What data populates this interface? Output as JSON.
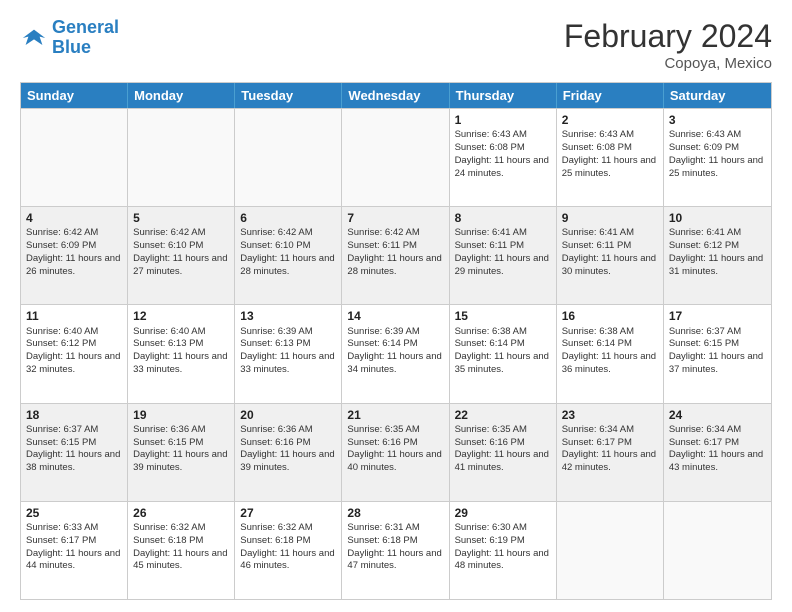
{
  "logo": {
    "line1": "General",
    "line2": "Blue"
  },
  "title": "February 2024",
  "location": "Copoya, Mexico",
  "days_header": [
    "Sunday",
    "Monday",
    "Tuesday",
    "Wednesday",
    "Thursday",
    "Friday",
    "Saturday"
  ],
  "rows": [
    [
      {
        "day": "",
        "info": "",
        "empty": true
      },
      {
        "day": "",
        "info": "",
        "empty": true
      },
      {
        "day": "",
        "info": "",
        "empty": true
      },
      {
        "day": "",
        "info": "",
        "empty": true
      },
      {
        "day": "1",
        "info": "Sunrise: 6:43 AM\nSunset: 6:08 PM\nDaylight: 11 hours and 24 minutes."
      },
      {
        "day": "2",
        "info": "Sunrise: 6:43 AM\nSunset: 6:08 PM\nDaylight: 11 hours and 25 minutes."
      },
      {
        "day": "3",
        "info": "Sunrise: 6:43 AM\nSunset: 6:09 PM\nDaylight: 11 hours and 25 minutes."
      }
    ],
    [
      {
        "day": "4",
        "info": "Sunrise: 6:42 AM\nSunset: 6:09 PM\nDaylight: 11 hours and 26 minutes."
      },
      {
        "day": "5",
        "info": "Sunrise: 6:42 AM\nSunset: 6:10 PM\nDaylight: 11 hours and 27 minutes."
      },
      {
        "day": "6",
        "info": "Sunrise: 6:42 AM\nSunset: 6:10 PM\nDaylight: 11 hours and 28 minutes."
      },
      {
        "day": "7",
        "info": "Sunrise: 6:42 AM\nSunset: 6:11 PM\nDaylight: 11 hours and 28 minutes."
      },
      {
        "day": "8",
        "info": "Sunrise: 6:41 AM\nSunset: 6:11 PM\nDaylight: 11 hours and 29 minutes."
      },
      {
        "day": "9",
        "info": "Sunrise: 6:41 AM\nSunset: 6:11 PM\nDaylight: 11 hours and 30 minutes."
      },
      {
        "day": "10",
        "info": "Sunrise: 6:41 AM\nSunset: 6:12 PM\nDaylight: 11 hours and 31 minutes."
      }
    ],
    [
      {
        "day": "11",
        "info": "Sunrise: 6:40 AM\nSunset: 6:12 PM\nDaylight: 11 hours and 32 minutes."
      },
      {
        "day": "12",
        "info": "Sunrise: 6:40 AM\nSunset: 6:13 PM\nDaylight: 11 hours and 33 minutes."
      },
      {
        "day": "13",
        "info": "Sunrise: 6:39 AM\nSunset: 6:13 PM\nDaylight: 11 hours and 33 minutes."
      },
      {
        "day": "14",
        "info": "Sunrise: 6:39 AM\nSunset: 6:14 PM\nDaylight: 11 hours and 34 minutes."
      },
      {
        "day": "15",
        "info": "Sunrise: 6:38 AM\nSunset: 6:14 PM\nDaylight: 11 hours and 35 minutes."
      },
      {
        "day": "16",
        "info": "Sunrise: 6:38 AM\nSunset: 6:14 PM\nDaylight: 11 hours and 36 minutes."
      },
      {
        "day": "17",
        "info": "Sunrise: 6:37 AM\nSunset: 6:15 PM\nDaylight: 11 hours and 37 minutes."
      }
    ],
    [
      {
        "day": "18",
        "info": "Sunrise: 6:37 AM\nSunset: 6:15 PM\nDaylight: 11 hours and 38 minutes."
      },
      {
        "day": "19",
        "info": "Sunrise: 6:36 AM\nSunset: 6:15 PM\nDaylight: 11 hours and 39 minutes."
      },
      {
        "day": "20",
        "info": "Sunrise: 6:36 AM\nSunset: 6:16 PM\nDaylight: 11 hours and 39 minutes."
      },
      {
        "day": "21",
        "info": "Sunrise: 6:35 AM\nSunset: 6:16 PM\nDaylight: 11 hours and 40 minutes."
      },
      {
        "day": "22",
        "info": "Sunrise: 6:35 AM\nSunset: 6:16 PM\nDaylight: 11 hours and 41 minutes."
      },
      {
        "day": "23",
        "info": "Sunrise: 6:34 AM\nSunset: 6:17 PM\nDaylight: 11 hours and 42 minutes."
      },
      {
        "day": "24",
        "info": "Sunrise: 6:34 AM\nSunset: 6:17 PM\nDaylight: 11 hours and 43 minutes."
      }
    ],
    [
      {
        "day": "25",
        "info": "Sunrise: 6:33 AM\nSunset: 6:17 PM\nDaylight: 11 hours and 44 minutes."
      },
      {
        "day": "26",
        "info": "Sunrise: 6:32 AM\nSunset: 6:18 PM\nDaylight: 11 hours and 45 minutes."
      },
      {
        "day": "27",
        "info": "Sunrise: 6:32 AM\nSunset: 6:18 PM\nDaylight: 11 hours and 46 minutes."
      },
      {
        "day": "28",
        "info": "Sunrise: 6:31 AM\nSunset: 6:18 PM\nDaylight: 11 hours and 47 minutes."
      },
      {
        "day": "29",
        "info": "Sunrise: 6:30 AM\nSunset: 6:19 PM\nDaylight: 11 hours and 48 minutes."
      },
      {
        "day": "",
        "info": "",
        "empty": true
      },
      {
        "day": "",
        "info": "",
        "empty": true
      }
    ]
  ]
}
